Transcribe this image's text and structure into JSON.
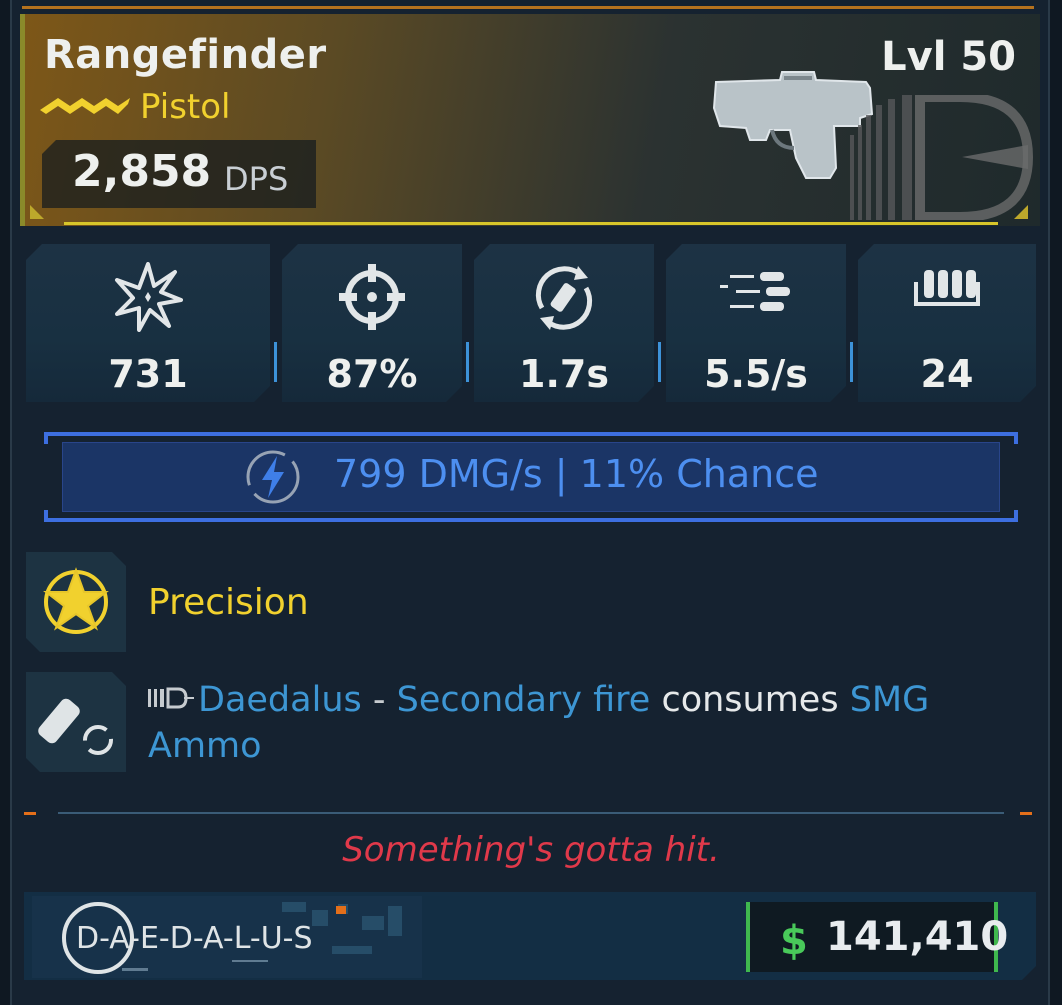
{
  "item": {
    "name": "Rangefinder",
    "type": "Pistol",
    "dps_value": "2,858",
    "dps_unit": "DPS",
    "level": "Lvl 50"
  },
  "stats": [
    {
      "icon": "damage-burst-icon",
      "value": "731"
    },
    {
      "icon": "crosshair-icon",
      "value": "87%"
    },
    {
      "icon": "reload-icon",
      "value": "1.7s"
    },
    {
      "icon": "fire-rate-icon",
      "value": "5.5/s"
    },
    {
      "icon": "magazine-icon",
      "value": "24"
    }
  ],
  "element": {
    "icon": "lightning-icon",
    "text": "799 DMG/s | 11% Chance",
    "color": "#4d8ff0"
  },
  "perks": [
    {
      "icon": "precision-star-icon",
      "name": "Precision"
    },
    {
      "icon": "ammo-swap-icon",
      "parts": [
        "Daedalus",
        " - ",
        "Secondary fire",
        " consumes ",
        "SMG Ammo"
      ]
    }
  ],
  "flavor_text": "Something's gotta hit.",
  "manufacturer": {
    "logo_text": "D-A-E-D-A-L-U-S"
  },
  "price": {
    "currency_icon": "$",
    "value": "141,410"
  },
  "colors": {
    "rarity": "#f1d12e",
    "flavor": "#e0394a",
    "price_accent": "#3fb84e",
    "stat_separator": "#3d92d8"
  }
}
